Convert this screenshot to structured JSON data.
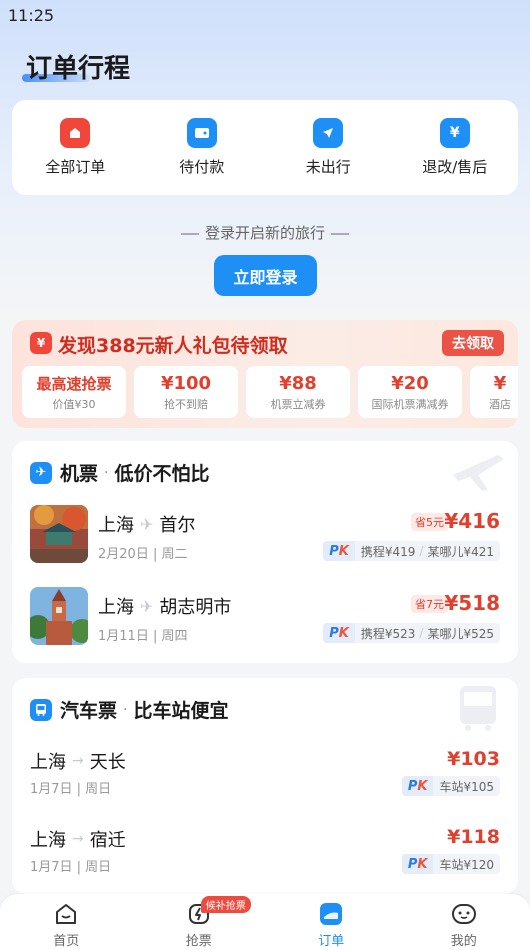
{
  "status_bar": {
    "time": "11:25"
  },
  "page_title": "订单行程",
  "order_tabs": [
    {
      "label": "全部订单",
      "icon": "all-orders-icon",
      "color": "#f0473a"
    },
    {
      "label": "待付款",
      "icon": "wallet-icon",
      "color": "#1e8ff5"
    },
    {
      "label": "未出行",
      "icon": "location-arrow-icon",
      "color": "#1e8ff5"
    },
    {
      "label": "退改/售后",
      "icon": "refund-icon",
      "color": "#1e8ff5"
    }
  ],
  "login": {
    "hint": "登录开启新的旅行",
    "button": "立即登录"
  },
  "promo": {
    "badge": "¥",
    "title": "发现388元新人礼包待领取",
    "claim": "去领取",
    "coupons": [
      {
        "main": "最高速抢票",
        "sub": "价值¥30"
      },
      {
        "main": "¥100",
        "sub": "抢不到赔"
      },
      {
        "main": "¥88",
        "sub": "机票立减券"
      },
      {
        "main": "¥20",
        "sub": "国际机票满减券"
      },
      {
        "main": "¥",
        "sub": "酒店"
      }
    ]
  },
  "flight": {
    "title": "机票",
    "subtitle": "低价不怕比",
    "dot": "·",
    "items": [
      {
        "from": "上海",
        "to": "首尔",
        "date": "2月20日 | 周二",
        "save": "省5元",
        "price": "¥416",
        "compare": [
          "携程¥419",
          "某哪儿¥421"
        ]
      },
      {
        "from": "上海",
        "to": "胡志明市",
        "date": "1月11日 | 周四",
        "save": "省7元",
        "price": "¥518",
        "compare": [
          "携程¥523",
          "某哪儿¥525"
        ]
      }
    ]
  },
  "bus": {
    "title": "汽车票",
    "subtitle": "比车站便宜",
    "dot": "·",
    "items": [
      {
        "from": "上海",
        "to": "天长",
        "date": "1月7日 | 周日",
        "price": "¥103",
        "compare": "车站¥105"
      },
      {
        "from": "上海",
        "to": "宿迁",
        "date": "1月7日 | 周日",
        "price": "¥118",
        "compare": "车站¥120"
      }
    ]
  },
  "pk": {
    "p": "P",
    "k": "K"
  },
  "tab_bar": {
    "items": [
      {
        "label": "首页",
        "icon": "home-icon"
      },
      {
        "label": "抢票",
        "icon": "grab-ticket-icon",
        "badge": "候补抢票"
      },
      {
        "label": "订单",
        "icon": "orders-icon",
        "active": true
      },
      {
        "label": "我的",
        "icon": "profile-icon"
      }
    ]
  }
}
